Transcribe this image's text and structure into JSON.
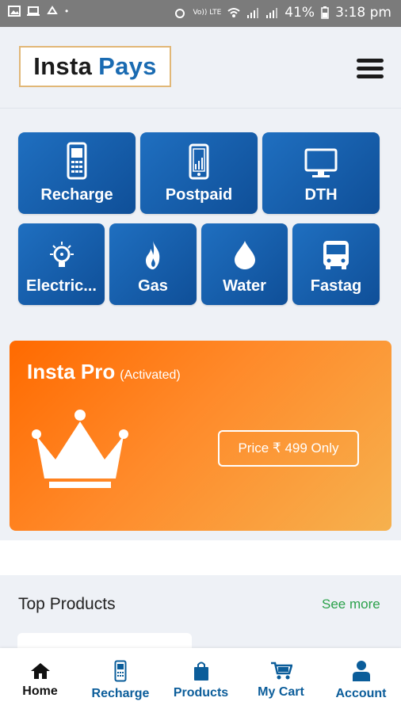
{
  "status_bar": {
    "battery": "41%",
    "time": "3:18 pm",
    "network_labels": "Vo)) LTE"
  },
  "header": {
    "logo_part1": "Insta",
    "logo_part2": "Pays"
  },
  "services": [
    {
      "label": "Recharge",
      "icon": "mobile-phone-icon"
    },
    {
      "label": "Postpaid",
      "icon": "smartphone-icon"
    },
    {
      "label": "DTH",
      "icon": "tv-monitor-icon"
    },
    {
      "label": "Electric...",
      "icon": "lightbulb-icon"
    },
    {
      "label": "Gas",
      "icon": "flame-icon"
    },
    {
      "label": "Water",
      "icon": "water-drop-icon"
    },
    {
      "label": "Fastag",
      "icon": "bus-icon"
    }
  ],
  "insta_pro": {
    "title": "Insta Pro",
    "status": "(Activated)",
    "price_label": "Price ₹ 499 Only",
    "icon": "crown-icon"
  },
  "top_products": {
    "title": "Top Products",
    "see_more": "See more"
  },
  "bottom_nav": [
    {
      "label": "Home",
      "icon": "home-icon",
      "active": true
    },
    {
      "label": "Recharge",
      "icon": "mobile-phone-icon",
      "active": false
    },
    {
      "label": "Products",
      "icon": "shopping-bag-icon",
      "active": false
    },
    {
      "label": "My Cart",
      "icon": "cart-icon",
      "active": false
    },
    {
      "label": "Account",
      "icon": "user-icon",
      "active": false
    }
  ],
  "colors": {
    "tile_blue": "#1662b0",
    "nav_blue": "#0b5d9a",
    "orange": "#ff6a00",
    "green": "#2aa14a"
  }
}
